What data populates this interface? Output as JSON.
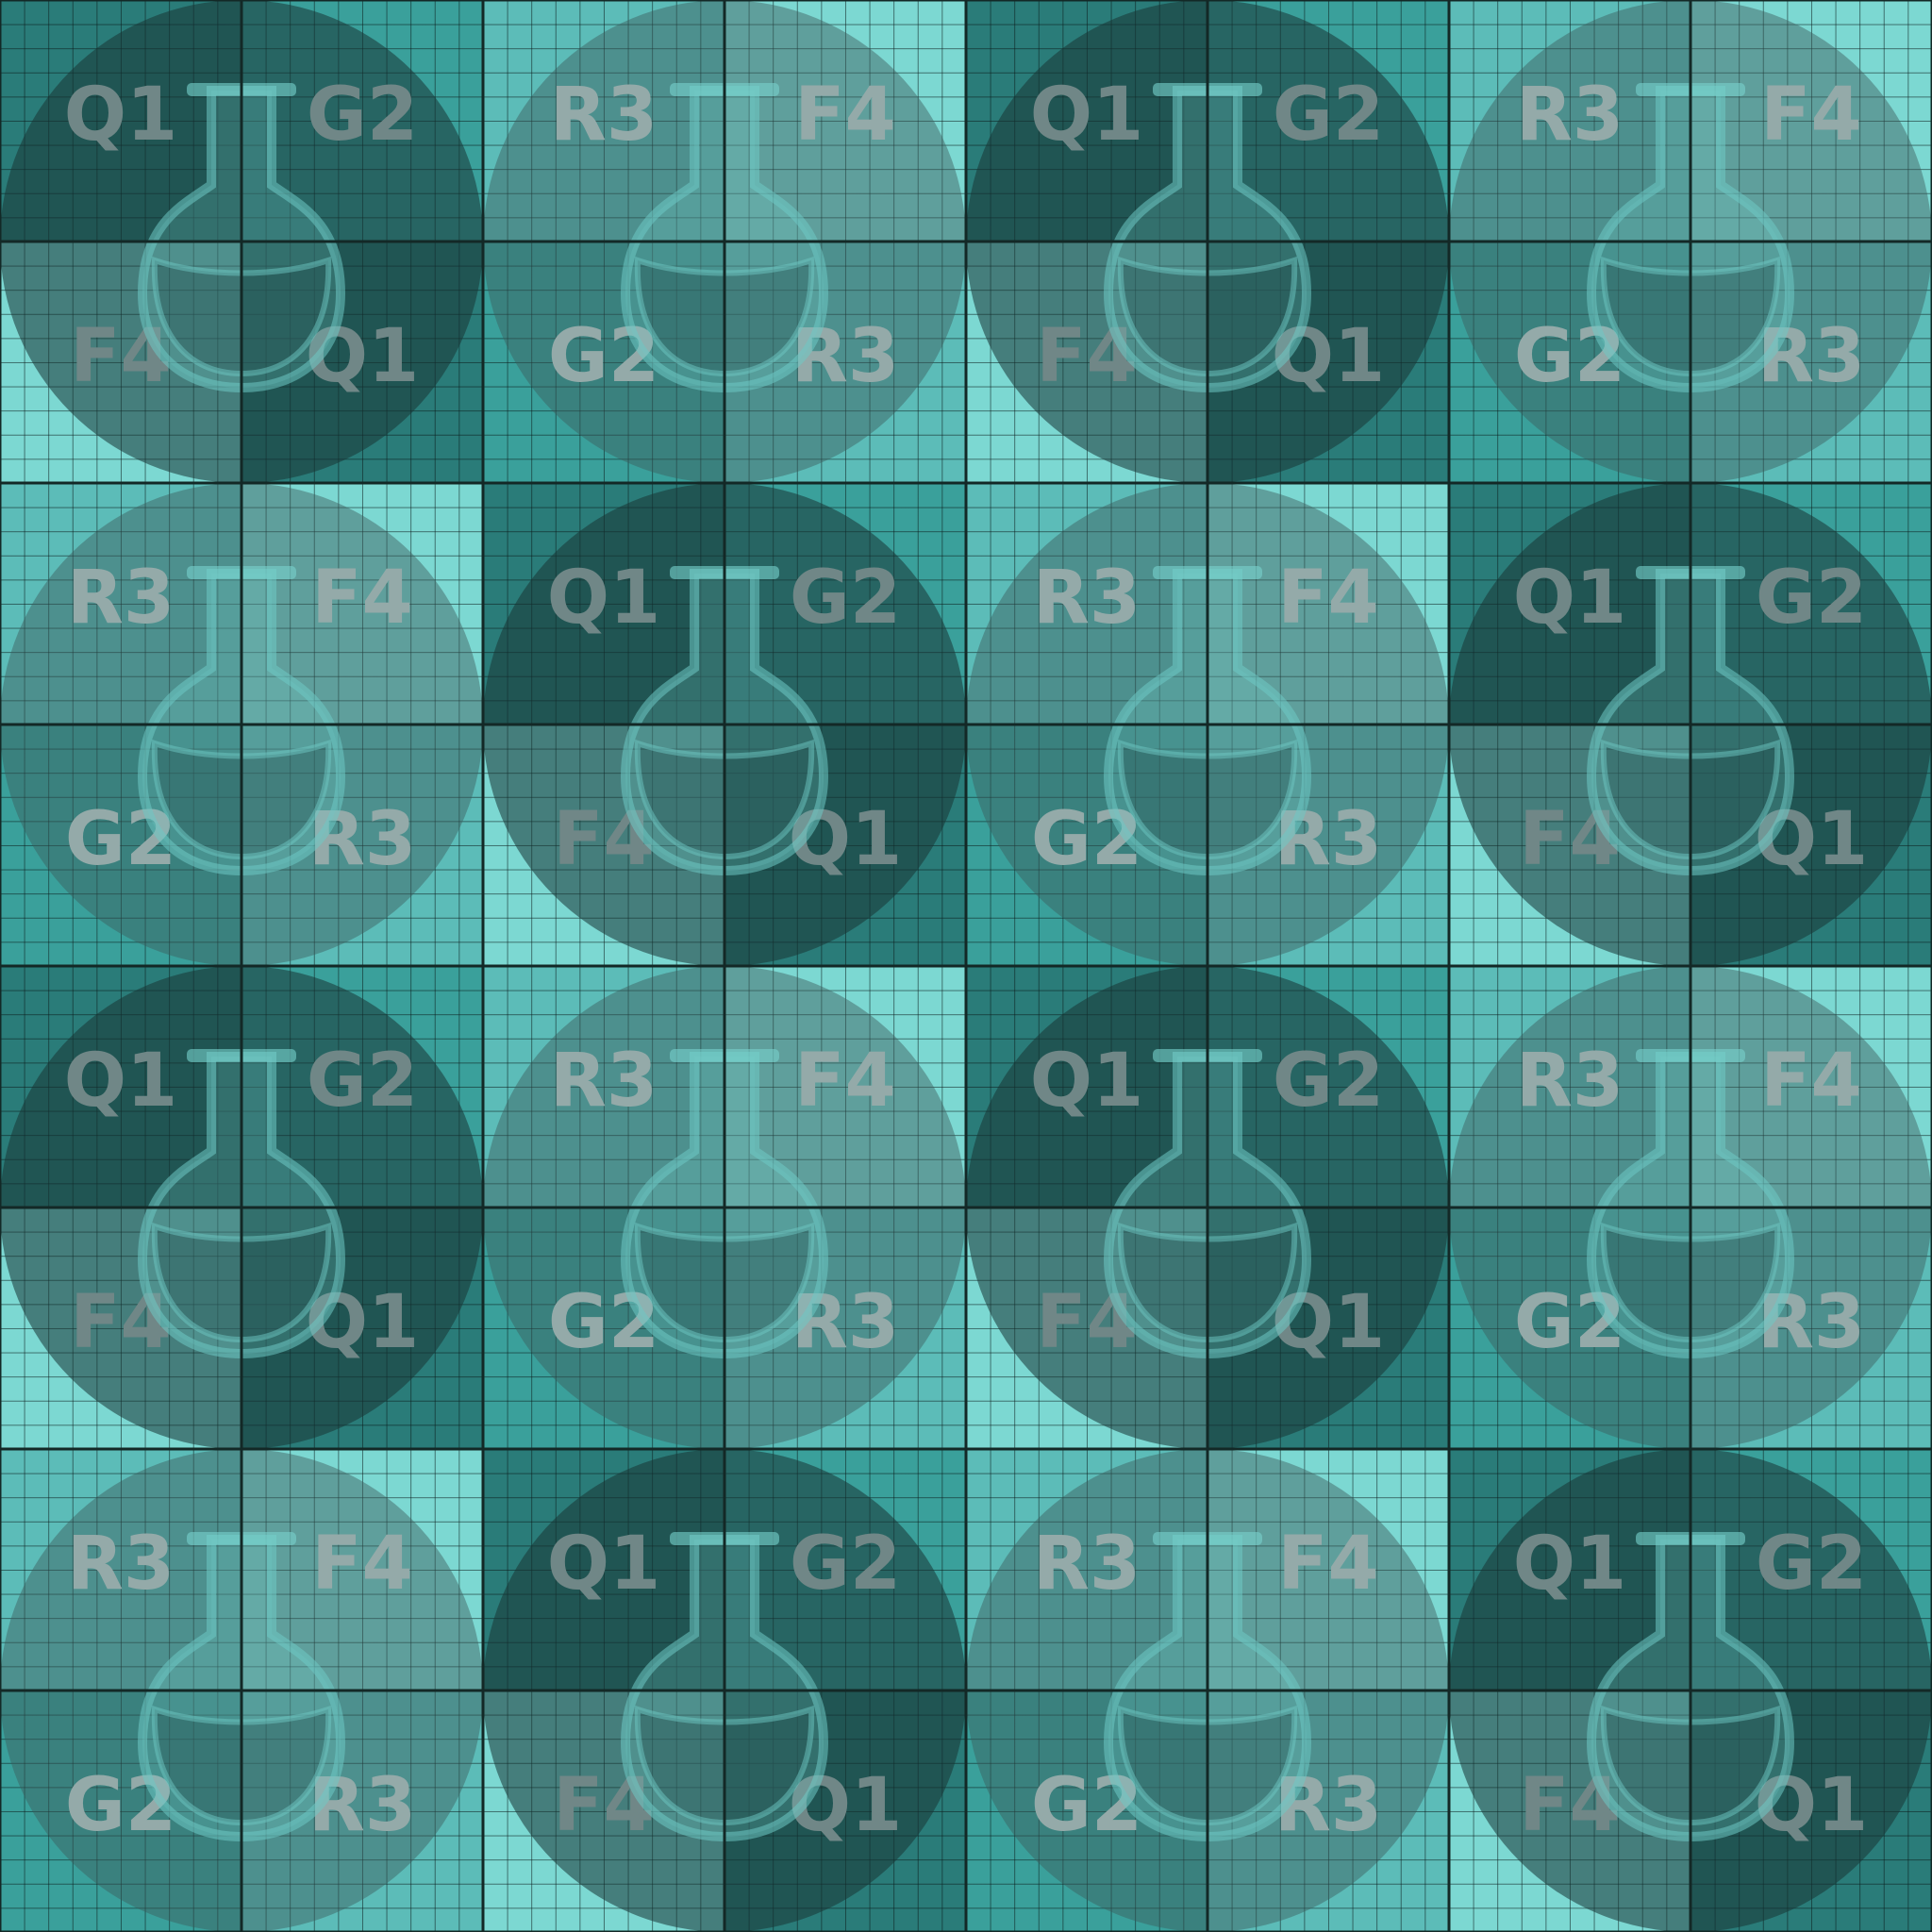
{
  "palette": {
    "Q1": "#2a7c79",
    "G2": "#3aa09b",
    "R3": "#5cbcb8",
    "F4": "#7cd8d2"
  },
  "tiles": [
    [
      "Q1",
      "G2",
      "R3",
      "F4",
      "Q1",
      "G2",
      "R3",
      "F4"
    ],
    [
      "F4",
      "Q1",
      "G2",
      "R3",
      "F4",
      "Q1",
      "G2",
      "R3"
    ],
    [
      "R3",
      "F4",
      "Q1",
      "G2",
      "R3",
      "F4",
      "Q1",
      "G2"
    ],
    [
      "G2",
      "R3",
      "F4",
      "Q1",
      "G2",
      "R3",
      "F4",
      "Q1"
    ],
    [
      "Q1",
      "G2",
      "R3",
      "F4",
      "Q1",
      "G2",
      "R3",
      "F4"
    ],
    [
      "F4",
      "Q1",
      "G2",
      "R3",
      "F4",
      "Q1",
      "G2",
      "R3"
    ],
    [
      "R3",
      "F4",
      "Q1",
      "G2",
      "R3",
      "F4",
      "Q1",
      "G2"
    ],
    [
      "G2",
      "R3",
      "F4",
      "Q1",
      "G2",
      "R3",
      "F4",
      "Q1"
    ]
  ],
  "circles": [
    {
      "shade": "dark"
    },
    {
      "shade": "mid"
    },
    {
      "shade": "dark"
    },
    {
      "shade": "mid"
    },
    {
      "shade": "mid"
    },
    {
      "shade": "dark"
    },
    {
      "shade": "mid"
    },
    {
      "shade": "dark"
    },
    {
      "shade": "dark"
    },
    {
      "shade": "mid"
    },
    {
      "shade": "dark"
    },
    {
      "shade": "mid"
    },
    {
      "shade": "mid"
    },
    {
      "shade": "dark"
    },
    {
      "shade": "mid"
    },
    {
      "shade": "dark"
    }
  ],
  "overlay_icon": "potion-flask-icon"
}
